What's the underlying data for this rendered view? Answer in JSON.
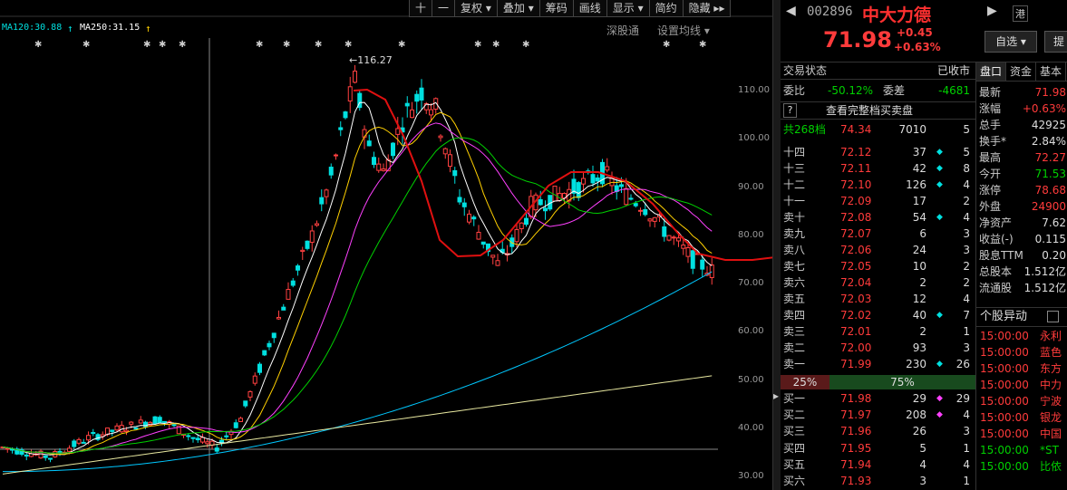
{
  "ma_legend": [
    {
      "text": "MA120:30.88",
      "color": "#00e0e0"
    },
    {
      "text": "MA250:31.15",
      "color": "#ffffff"
    }
  ],
  "toolbar": [
    "十",
    "一",
    "复权 ▾",
    "叠加 ▾",
    "筹码",
    "画线",
    "显示 ▾",
    "简约",
    "隐藏 ▸▸"
  ],
  "chart_header": {
    "index": "深股通",
    "settings": "设置均线 ▾"
  },
  "peak_label": "←116.27",
  "chart_data": {
    "type": "candlestick",
    "y_ticks": [
      "110.00",
      "100.00",
      "90.00",
      "80.00",
      "70.00",
      "60.00",
      "50.00",
      "40.00",
      "30.00"
    ],
    "ylim": [
      30,
      116.27
    ],
    "max_price": 116.27,
    "ma_labels": [
      "MA120:30.88",
      "MA250:31.15"
    ]
  },
  "stock": {
    "code": "002896",
    "name": "中大力德",
    "market_tag": "港",
    "price": "71.98",
    "change": "+0.45",
    "change_pct": "+0.63%",
    "watchlist_btn": "自选 ▾",
    "extra_btn": "提"
  },
  "order_book": {
    "status_label": "交易状态",
    "status_value": "已收市",
    "wb_label": "委比",
    "wb_value": "-50.12%",
    "wc_label": "委差",
    "wc_value": "-4681",
    "full_depth_q": "?",
    "full_depth": "查看完整档买卖盘",
    "total_label": "共268档",
    "total_price": "74.34",
    "total_vol": "7010",
    "total_cnt": "5",
    "asks": [
      {
        "label": "十四",
        "price": "72.12",
        "vol": "37",
        "dot": "#00e0e0",
        "cnt": "5"
      },
      {
        "label": "十三",
        "price": "72.11",
        "vol": "42",
        "dot": "#00e0e0",
        "cnt": "8"
      },
      {
        "label": "十二",
        "price": "72.10",
        "vol": "126",
        "dot": "#00e0e0",
        "cnt": "4"
      },
      {
        "label": "十一",
        "price": "72.09",
        "vol": "17",
        "dot": "",
        "cnt": "2"
      },
      {
        "label": "卖十",
        "price": "72.08",
        "vol": "54",
        "dot": "#00e0e0",
        "cnt": "4"
      },
      {
        "label": "卖九",
        "price": "72.07",
        "vol": "6",
        "dot": "",
        "cnt": "3"
      },
      {
        "label": "卖八",
        "price": "72.06",
        "vol": "24",
        "dot": "",
        "cnt": "3"
      },
      {
        "label": "卖七",
        "price": "72.05",
        "vol": "10",
        "dot": "",
        "cnt": "2"
      },
      {
        "label": "卖六",
        "price": "72.04",
        "vol": "2",
        "dot": "",
        "cnt": "2"
      },
      {
        "label": "卖五",
        "price": "72.03",
        "vol": "12",
        "dot": "",
        "cnt": "4"
      },
      {
        "label": "卖四",
        "price": "72.02",
        "vol": "40",
        "dot": "#00e0e0",
        "cnt": "7"
      },
      {
        "label": "卖三",
        "price": "72.01",
        "vol": "2",
        "dot": "",
        "cnt": "1"
      },
      {
        "label": "卖二",
        "price": "72.00",
        "vol": "93",
        "dot": "",
        "cnt": "3"
      },
      {
        "label": "卖一",
        "price": "71.99",
        "vol": "230",
        "dot": "#00e0e0",
        "cnt": "26"
      }
    ],
    "ratio_left": "25%",
    "ratio_right": "75%",
    "ratio_fraction": 0.25,
    "bids": [
      {
        "label": "买一",
        "price": "71.98",
        "vol": "29",
        "dot": "#ff40ff",
        "cnt": "29"
      },
      {
        "label": "买二",
        "price": "71.97",
        "vol": "208",
        "dot": "#ff40ff",
        "cnt": "4"
      },
      {
        "label": "买三",
        "price": "71.96",
        "vol": "26",
        "dot": "",
        "cnt": "3"
      },
      {
        "label": "买四",
        "price": "71.95",
        "vol": "5",
        "dot": "",
        "cnt": "1"
      },
      {
        "label": "买五",
        "price": "71.94",
        "vol": "4",
        "dot": "",
        "cnt": "4"
      },
      {
        "label": "买六",
        "price": "71.93",
        "vol": "3",
        "dot": "",
        "cnt": "1"
      }
    ]
  },
  "quote": {
    "tabs": [
      "盘口",
      "资金",
      "基本"
    ],
    "rows": [
      {
        "label": "最新",
        "value": "71.98",
        "color": "#ff3b3b"
      },
      {
        "label": "涨幅",
        "value": "+0.63%",
        "color": "#ff3b3b"
      },
      {
        "label": "总手",
        "value": "42925",
        "color": "#dddddd"
      },
      {
        "label": "换手*",
        "value": "2.84%",
        "color": "#dddddd"
      },
      {
        "label": "最高",
        "value": "72.27",
        "color": "#ff3b3b"
      },
      {
        "label": "今开",
        "value": "71.53",
        "color": "#00d000"
      },
      {
        "label": "涨停",
        "value": "78.68",
        "color": "#ff3b3b"
      },
      {
        "label": "外盘",
        "value": "24900",
        "color": "#ff3b3b"
      },
      {
        "label": "净资产",
        "value": "7.62",
        "color": "#dddddd"
      },
      {
        "label": "收益(-)",
        "value": "0.115",
        "color": "#dddddd"
      },
      {
        "label": "股息TTM",
        "value": "0.20",
        "color": "#dddddd"
      },
      {
        "label": "总股本",
        "value": "1.512亿",
        "color": "#dddddd"
      },
      {
        "label": "流通股",
        "value": "1.512亿",
        "color": "#dddddd"
      }
    ],
    "alerts_title": "个股异动",
    "alerts": [
      {
        "time": "15:00:00",
        "text": "永利",
        "color": "#ff3b3b"
      },
      {
        "time": "15:00:00",
        "text": "蓝色",
        "color": "#ff3b3b"
      },
      {
        "time": "15:00:00",
        "text": "东方",
        "color": "#ff3b3b"
      },
      {
        "time": "15:00:00",
        "text": "中力",
        "color": "#ff3b3b"
      },
      {
        "time": "15:00:00",
        "text": "宁波",
        "color": "#ff3b3b"
      },
      {
        "time": "15:00:00",
        "text": "银龙",
        "color": "#ff3b3b"
      },
      {
        "time": "15:00:00",
        "text": "中国",
        "color": "#ff3b3b"
      },
      {
        "time": "15:00:00",
        "text": "*ST",
        "color": "#00d000"
      },
      {
        "time": "15:00:00",
        "text": "比依",
        "color": "#00d000"
      }
    ]
  }
}
